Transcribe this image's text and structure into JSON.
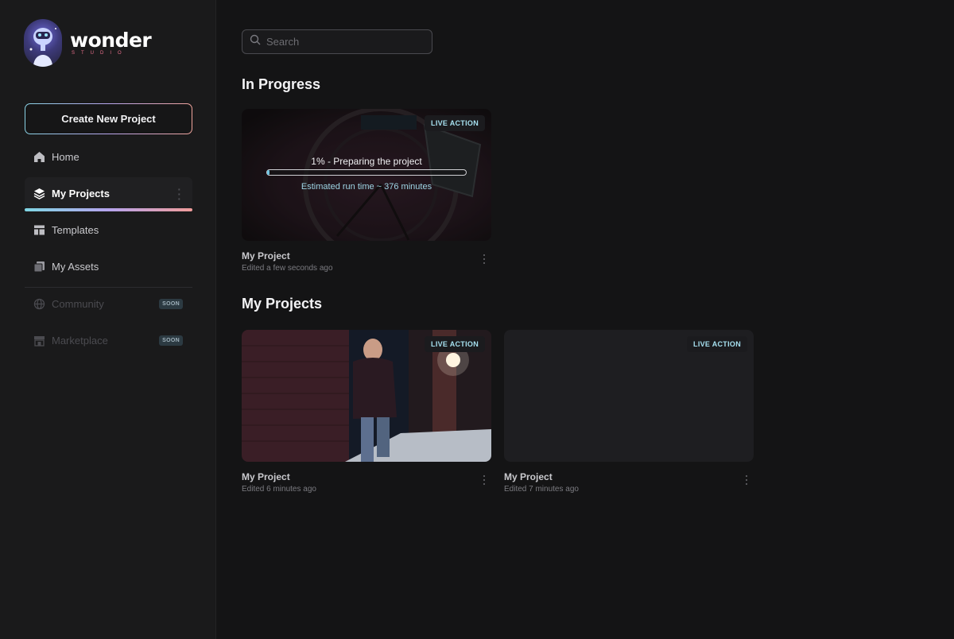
{
  "brand": {
    "name": "wonder",
    "sub": "STUDIO"
  },
  "sidebar": {
    "create_label": "Create New Project",
    "items": [
      {
        "label": "Home",
        "icon": "home-icon"
      },
      {
        "label": "My Projects",
        "icon": "layers-icon",
        "active": true
      },
      {
        "label": "Templates",
        "icon": "templates-icon"
      },
      {
        "label": "My Assets",
        "icon": "assets-icon"
      },
      {
        "label": "Community",
        "icon": "globe-icon",
        "badge": "SOON"
      },
      {
        "label": "Marketplace",
        "icon": "store-icon",
        "badge": "SOON"
      }
    ]
  },
  "search": {
    "placeholder": "Search"
  },
  "sections": {
    "in_progress": "In Progress",
    "my_projects": "My Projects"
  },
  "in_progress_card": {
    "badge": "LIVE ACTION",
    "progress_text": "1% - Preparing the project",
    "progress_value": 0.01,
    "eta": "Estimated run time ~ 376 minutes",
    "title": "My Project",
    "edited": "Edited a few seconds ago"
  },
  "projects": [
    {
      "badge": "LIVE ACTION",
      "title": "My Project",
      "edited": "Edited 6 minutes ago"
    },
    {
      "badge": "LIVE ACTION",
      "title": "My Project",
      "edited": "Edited 7 minutes ago"
    }
  ],
  "colors": {
    "accent_cyan": "#a6e0ef",
    "gradient": [
      "#8ad3e6",
      "#b9a6ef",
      "#f0a49c"
    ]
  }
}
